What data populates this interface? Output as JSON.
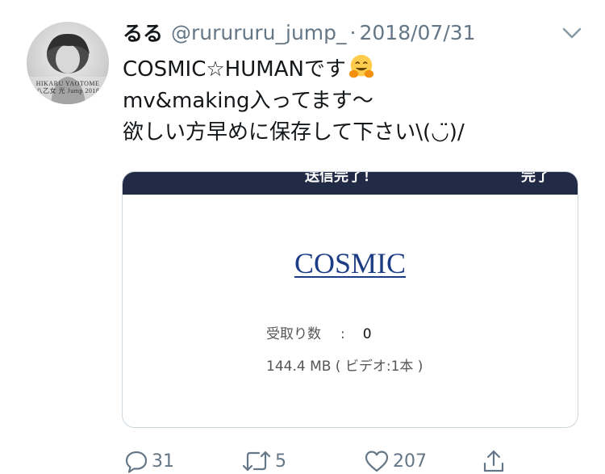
{
  "tweet": {
    "author": {
      "display_name": "るる",
      "handle": "@rurururu_jump_",
      "avatar_caption_line1": "HIKARU YAOTOME",
      "avatar_caption_line2": "八乙女 光 Jump 2018"
    },
    "separator": "·",
    "date": "2018/07/31",
    "text_lines": [
      "COSMIC☆HUMANです",
      "mv&making入ってます〜",
      "欲しい方早めに保存して下さい\\(◡̈)/"
    ],
    "emoji": "hugging-face",
    "media": {
      "top_bar_left": "送信完了！",
      "top_bar_right": "完了",
      "link_text": "COSMIC",
      "received_label": "受取り数",
      "received_colon": ":",
      "received_value": "0",
      "size_text": "144.4 MB ( ビデオ:1本 )"
    },
    "actions": {
      "reply_count": "31",
      "retweet_count": "5",
      "like_count": "207"
    }
  },
  "colors": {
    "text_primary": "#14171a",
    "text_secondary": "#657786",
    "card_border": "#ccd6dd",
    "card_topbar": "#222b45",
    "link": "#1d3c86"
  },
  "icons": [
    "more-caret-icon",
    "reply-icon",
    "retweet-icon",
    "like-icon",
    "share-icon",
    "hugging-face-emoji"
  ]
}
